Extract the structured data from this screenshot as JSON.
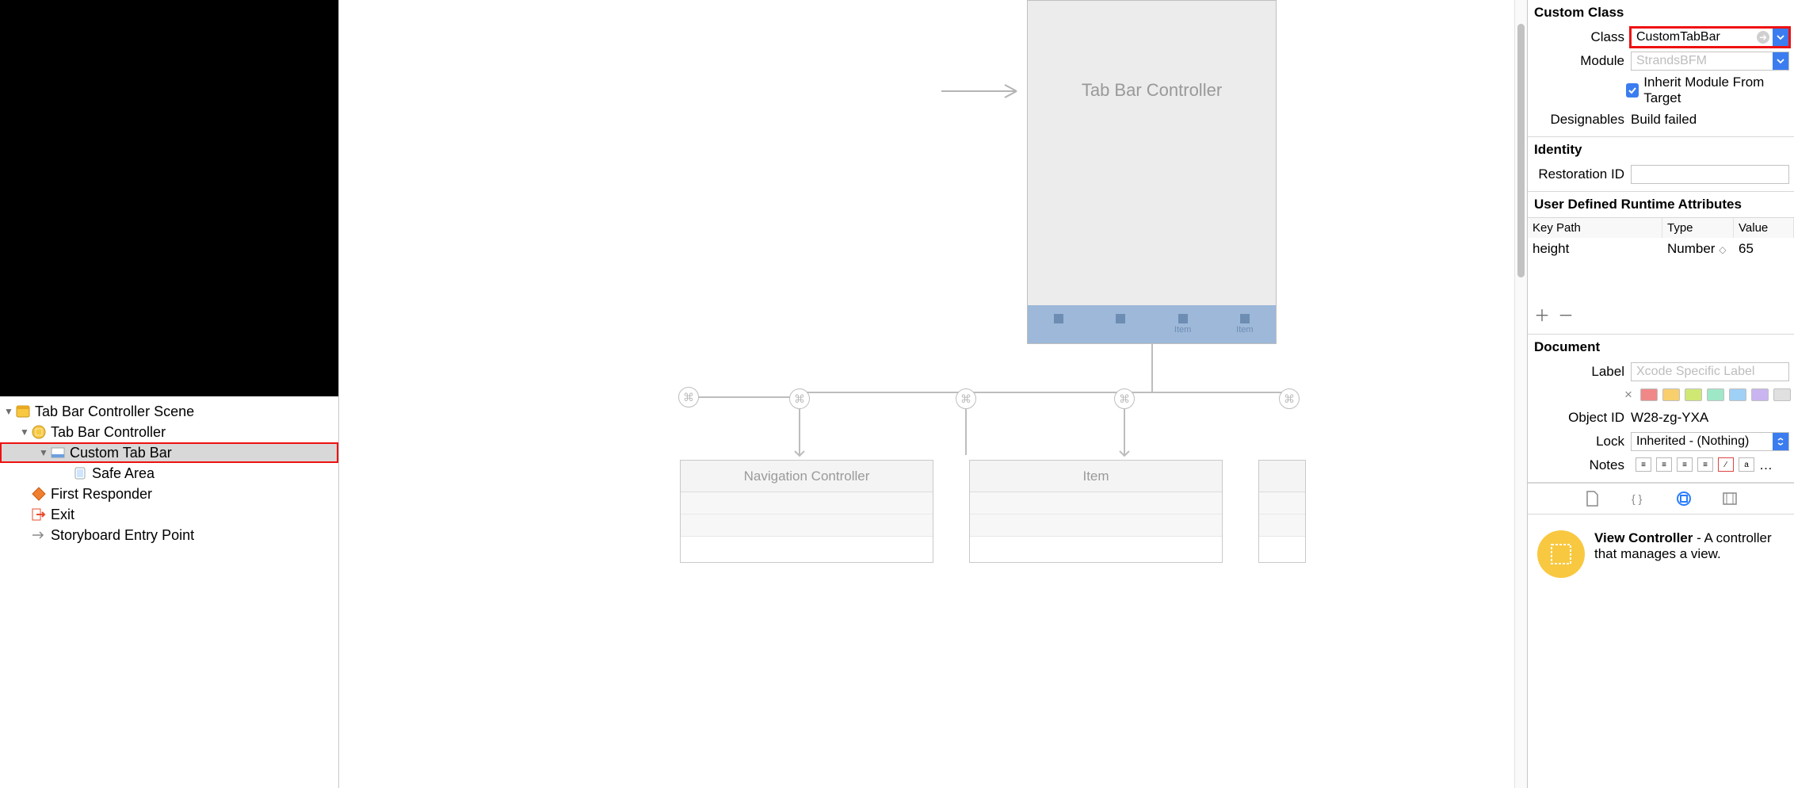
{
  "outline": {
    "scene": "Tab Bar Controller Scene",
    "items": [
      "Tab Bar Controller",
      "Custom Tab Bar",
      "Safe Area",
      "First Responder",
      "Exit",
      "Storyboard Entry Point"
    ]
  },
  "canvas": {
    "phone_title": "Tab Bar Controller",
    "tab_item_label": "Item",
    "child_boxes": [
      "Navigation Controller",
      "Item"
    ]
  },
  "inspector": {
    "custom_class": {
      "header": "Custom Class",
      "class_label": "Class",
      "class_value": "CustomTabBar",
      "module_label": "Module",
      "module_placeholder": "StrandsBFM",
      "inherit_label": "Inherit Module From Target",
      "designables_label": "Designables",
      "designables_value": "Build failed"
    },
    "identity": {
      "header": "Identity",
      "restoration_label": "Restoration ID"
    },
    "runtime": {
      "header": "User Defined Runtime Attributes",
      "cols": [
        "Key Path",
        "Type",
        "Value"
      ],
      "row": {
        "key": "height",
        "type": "Number",
        "value": "65"
      }
    },
    "document": {
      "header": "Document",
      "label_label": "Label",
      "label_placeholder": "Xcode Specific Label",
      "object_id_label": "Object ID",
      "object_id_value": "W28-zg-YXA",
      "lock_label": "Lock",
      "lock_value": "Inherited - (Nothing)",
      "notes_label": "Notes",
      "swatches": [
        "#f08888",
        "#f8cf6c",
        "#cfe873",
        "#9fe8c7",
        "#9fd0f5",
        "#c9b5ef",
        "#e0e0e0"
      ]
    },
    "library": {
      "title": "View Controller",
      "desc": " - A controller that manages a view."
    }
  }
}
